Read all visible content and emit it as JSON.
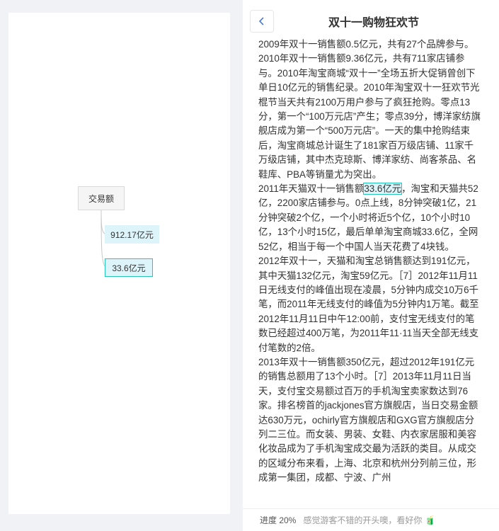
{
  "header": {
    "title": "双十一购物狂欢节"
  },
  "mindmap": {
    "root": "交易额",
    "children": [
      "912.17亿元",
      "33.6亿元"
    ]
  },
  "article": {
    "p1": "2009年双十一销售额0.5亿元，共有27个品牌参与。",
    "p2": "2010年双十一销售额9.36亿元，共有711家店铺参与。2010年淘宝商城“双十一”全场五折大促销曾创下单日10亿元的销售纪录。2010年淘宝双十一狂欢节光棍节当天共有2100万用户参与了疯狂抢购。零点13分，第一个“100万元店”产生；零点39分，博洋家纺旗舰店成为第一个“500万元店”。一天的集中抢购结束后，淘宝商城总计诞生了181家百万级店铺、11家千万级店铺，其中杰克琼斯、博洋家纺、尚客茶品、名鞋库、PBA等销量尤为突出。",
    "p3_before": "2011年天猫双十一销售额",
    "p3_highlight": "33.6亿元",
    "p3_after": "，淘宝和天猫共52亿，2200家店铺参与。0点上线，8分钟突破1亿，21分钟突破2个亿，一个小时将近5个亿，10个小时10亿，13个小时15亿，最后单单淘宝商城33.6亿，全网52亿，相当于每一个中国人当天花费了4块钱。",
    "p4": "2012年双十一，天猫和淘宝总销售额达到191亿元，其中天猫132亿元，淘宝59亿元。［7］2012年11月11日无线支付的峰值出现在凌晨，5分钟内成交10万6千笔，而2011年无线支付的峰值为5分钟内1万笔。截至2012年11月11日中午12:00前，支付宝无线支付的笔数已经超过400万笔，为2011年11·11当天全部无线支付笔数的2倍。",
    "p5": "2013年双十一销售额350亿元，超过2012年191亿元的销售总额用了13个小时。［7］2013年11月11日当天，支付宝交易额过百万的手机淘宝卖家数达到76家。排名榜首的jackjones官方旗舰店，当日交易金额达630万元，ochirly官方旗舰店和GXG官方旗舰店分列二三位。而女装、男装、女鞋、内衣家居服和美容化妆品成为了手机淘宝成交最为活跃的类目。从成交的区域分布来看，上海、北京和杭州分列前三位，形成第一集团，成都、宁波、广州"
  },
  "footer": {
    "progress": "进度 20%",
    "hint": "感觉游客不错的开头噢，看好你",
    "hint_icon": "🧃"
  },
  "colors": {
    "highlight_bg": "#ddf5fa",
    "highlight_border": "#26c6c0",
    "back_arrow": "#3a6fd8"
  }
}
